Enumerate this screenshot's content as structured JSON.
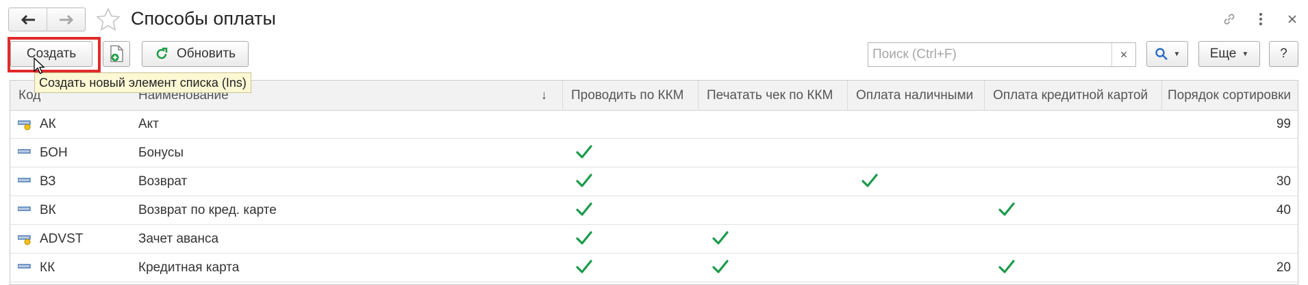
{
  "window": {
    "title": "Способы оплаты",
    "icons": [
      "back-arrow-icon",
      "forward-arrow-icon",
      "favorite-star-icon",
      "link-icon",
      "more-vertical-icon",
      "close-icon"
    ]
  },
  "toolbar": {
    "create_label": "Создать",
    "refresh_label": "Обновить",
    "search_placeholder": "Поиск (Ctrl+F)",
    "search_clear": "×",
    "more_label": "Еще",
    "help_label": "?"
  },
  "tooltip": {
    "text": "Создать новый элемент списка (Ins)"
  },
  "table": {
    "columns": [
      "Код",
      "Наименование",
      "Проводить по ККМ",
      "Печатать чек по ККМ",
      "Оплата наличными",
      "Оплата кредитной картой",
      "Порядок сортировки"
    ],
    "sort_indicator": "↓",
    "rows": [
      {
        "code": "АК",
        "name": "Акт",
        "kkm": false,
        "print": false,
        "cash": false,
        "card": false,
        "sort": "99",
        "marked": true
      },
      {
        "code": "БОН",
        "name": "Бонусы",
        "kkm": true,
        "print": false,
        "cash": false,
        "card": false,
        "sort": "",
        "marked": false
      },
      {
        "code": "ВЗ",
        "name": "Возврат",
        "kkm": true,
        "print": false,
        "cash": true,
        "card": false,
        "sort": "30",
        "marked": false
      },
      {
        "code": "ВК",
        "name": "Возврат по кред. карте",
        "kkm": true,
        "print": false,
        "cash": false,
        "card": true,
        "sort": "40",
        "marked": false
      },
      {
        "code": "ADVST",
        "name": "Зачет аванса",
        "kkm": true,
        "print": true,
        "cash": false,
        "card": false,
        "sort": "",
        "marked": true
      },
      {
        "code": "КК",
        "name": "Кредитная карта",
        "kkm": true,
        "print": true,
        "cash": false,
        "card": true,
        "sort": "20",
        "marked": false
      }
    ]
  },
  "colors": {
    "accent_red": "#e02b2b",
    "check_green": "#1a9a4a",
    "tooltip_bg": "#fdf8d4"
  }
}
